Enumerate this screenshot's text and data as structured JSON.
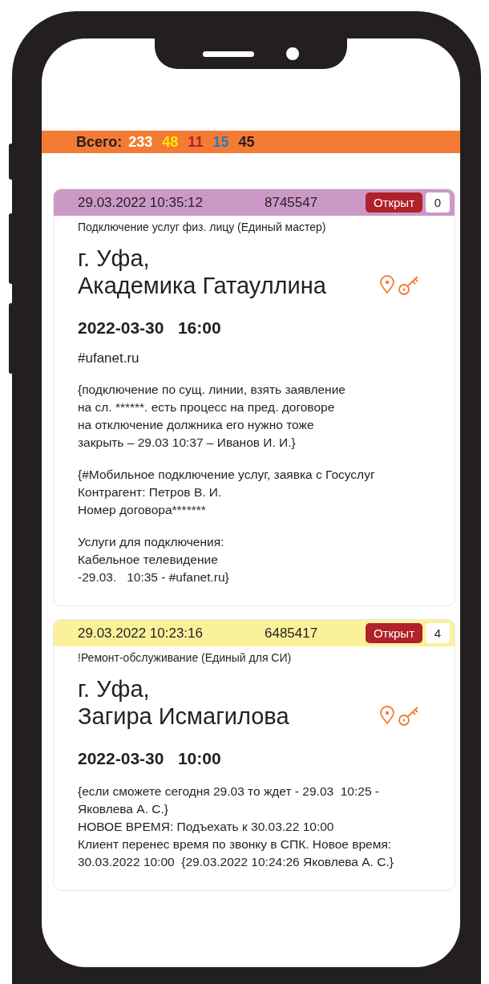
{
  "summary": {
    "label": "Всего:",
    "counts": [
      {
        "value": "233",
        "color": "#ffffff"
      },
      {
        "value": "48",
        "color": "#ffe600"
      },
      {
        "value": "11",
        "color": "#b5202a"
      },
      {
        "value": "15",
        "color": "#2b78c0"
      },
      {
        "value": "45",
        "color": "#231f20"
      }
    ]
  },
  "orders": [
    {
      "created": "29.03.2022 10:35:12",
      "number": "8745547",
      "color": "#cc99c7",
      "status": "Открыт",
      "count": "0",
      "category": "Подключение услуг физ. лицу (Единый мастер)",
      "address": [
        "г. Уфа,",
        "Академика Гатауллина"
      ],
      "scheduled": "2022-03-30   16:00",
      "tag": "#ufanet.ru",
      "notes": [
        "{подключение по сущ. линии, взять заявление\nна сл. ******. есть процесс на пред. договоре\nна отключение должника его нужно тоже\nзакрыть – 29.03 10:37 – Иванов И. И.}",
        "{#Мобильное подключение услуг, заявка с Госуслуг\nКонтрагент: Петров В. И.\nНомер договора*******",
        "Услуги для подключения:\nКабельное телевидение\n-29.03.   10:35 - #ufanet.ru}"
      ]
    },
    {
      "created": "29.03.2022 10:23:16",
      "number": "6485417",
      "color": "#faf29a",
      "status": "Открыт",
      "count": "4",
      "category": "!Ремонт-обслуживание (Единый для СИ)",
      "address": [
        "г. Уфа,",
        "Загира Исмагилова"
      ],
      "scheduled": "2022-03-30   10:00",
      "notes": [
        "{если сможете сегодня 29.03 то ждет - 29.03  10:25 -\nЯковлева А. С.}\nНОВОЕ ВРЕМЯ: Подъехать к 30.03.22 10:00\nКлиент перенес время по звонку в СПК. Новое время:\n30.03.2022 10:00  {29.03.2022 10:24:26 Яковлева А. С.}"
      ]
    }
  ]
}
